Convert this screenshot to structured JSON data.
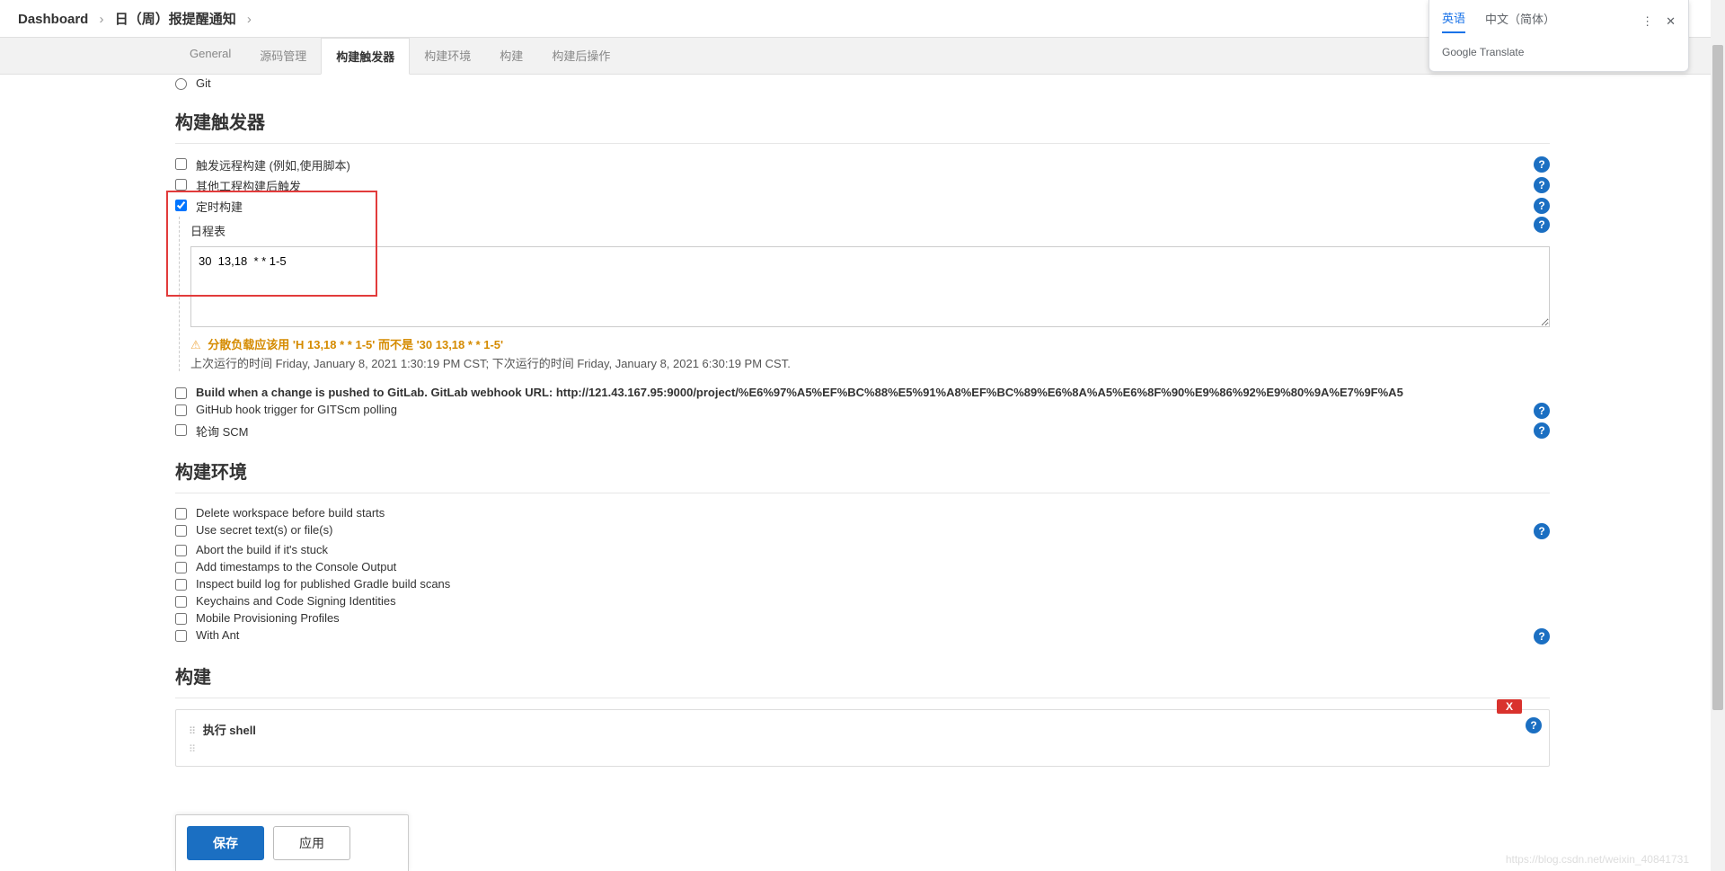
{
  "breadcrumb": {
    "dashboard": "Dashboard",
    "project": "日（周）报提醒通知"
  },
  "tabs": {
    "general": "General",
    "scm": "源码管理",
    "triggers": "构建触发器",
    "env": "构建环境",
    "build": "构建",
    "post": "构建后操作"
  },
  "radio": {
    "git": "Git"
  },
  "section": {
    "triggers": "构建触发器",
    "env": "构建环境",
    "build": "构建"
  },
  "trigger": {
    "remote": "触发远程构建 (例如,使用脚本)",
    "after": "其他工程构建后触发",
    "timed": "定时构建",
    "schedule_label": "日程表",
    "schedule_value": "30  13,18  * * 1-5",
    "warn": "分散负载应该用 'H  13,18  * * 1-5' 而不是 '30  13,18  * * 1-5'",
    "runtime": "上次运行的时间 Friday, January 8, 2021 1:30:19 PM CST; 下次运行的时间 Friday, January 8, 2021 6:30:19 PM CST.",
    "gitlab": "Build when a change is pushed to GitLab. GitLab webhook URL: http://121.43.167.95:9000/project/%E6%97%A5%EF%BC%88%E5%91%A8%EF%BC%89%E6%8A%A5%E6%8F%90%E9%86%92%E9%80%9A%E7%9F%A5",
    "gitscm": "GitHub hook trigger for GITScm polling",
    "poll": "轮询 SCM"
  },
  "env": {
    "delete": "Delete workspace before build starts",
    "secret": "Use secret text(s) or file(s)",
    "abort": "Abort the build if it's stuck",
    "timestamp": "Add timestamps to the Console Output",
    "gradle": "Inspect build log for published Gradle build scans",
    "keychain": "Keychains and Code Signing Identities",
    "mobile": "Mobile Provisioning Profiles",
    "ant": "With Ant"
  },
  "buildstep": {
    "shell": "执行 shell",
    "x": "X"
  },
  "footer": {
    "save": "保存",
    "apply": "应用"
  },
  "translate": {
    "en": "英语",
    "zh": "中文（简体）",
    "brand": "Google Translate",
    "dots": "⋮",
    "close": "✕"
  },
  "icons": {
    "warn": "⚠",
    "help": "?",
    "sep": "›"
  },
  "watermark": "https://blog.csdn.net/weixin_40841731"
}
